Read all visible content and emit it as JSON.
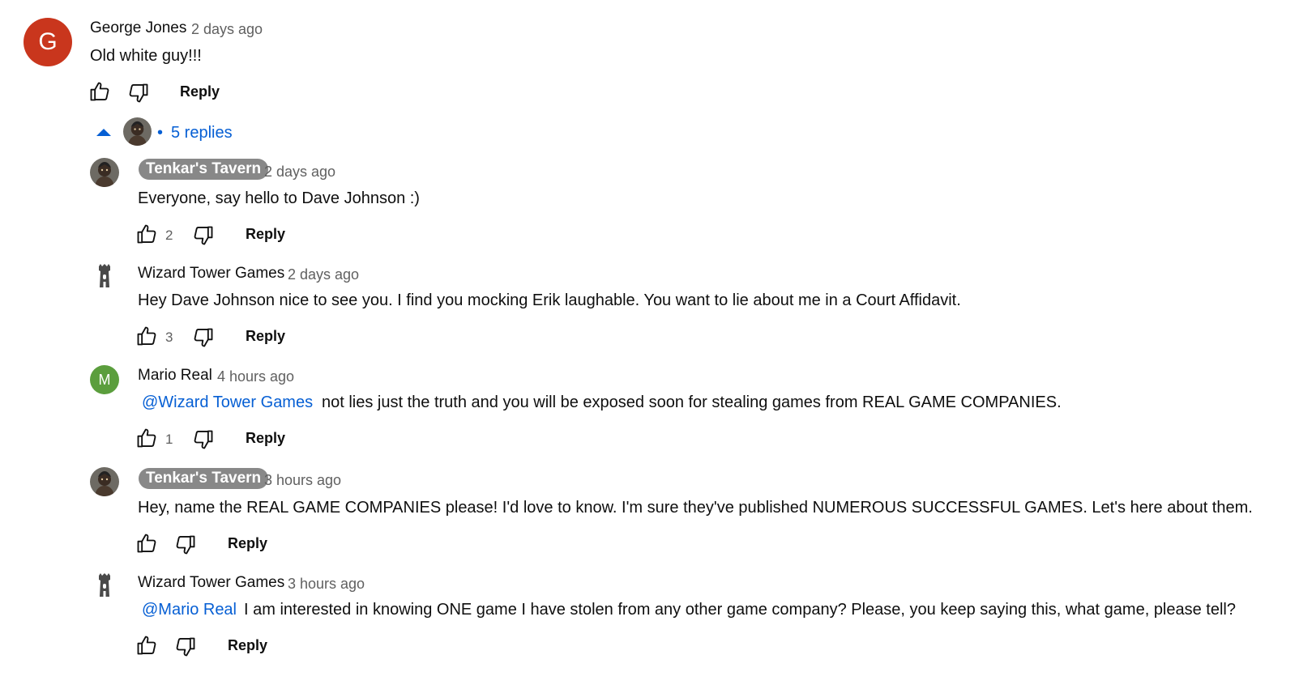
{
  "top_comment": {
    "avatar_letter": "G",
    "avatar_color": "#c9361d",
    "author": "George Jones",
    "time": "2 days ago",
    "text": "Old white guy!!!",
    "reply_label": "Reply"
  },
  "replies_toggle": {
    "bullet": "•",
    "label": "5 replies"
  },
  "replies": [
    {
      "author": "Tenkar's Tavern",
      "time": "2 days ago",
      "text": "Everyone, say hello to Dave Johnson :)",
      "likes": "2",
      "reply_label": "Reply"
    },
    {
      "author": "Wizard Tower Games",
      "time": "2 days ago",
      "text": "Hey Dave Johnson nice to see you. I find you mocking Erik laughable. You want to lie about me in a Court Affidavit.",
      "likes": "3",
      "reply_label": "Reply"
    },
    {
      "author": "Mario Real",
      "avatar_letter": "M",
      "avatar_color": "#5b9e3d",
      "time": "4 hours ago",
      "mention": "@Wizard Tower Games",
      "text": "not lies just the truth and you will be exposed soon for stealing games from REAL GAME COMPANIES.",
      "likes": "1",
      "reply_label": "Reply"
    },
    {
      "author": "Tenkar's Tavern",
      "time": "3 hours ago",
      "text": "Hey, name the REAL GAME COMPANIES please! I'd love to know. I'm sure they've published NUMEROUS SUCCESSFUL GAMES. Let's here about them.",
      "reply_label": "Reply"
    },
    {
      "author": "Wizard Tower Games",
      "time": "3 hours ago",
      "mention": "@Mario Real",
      "text": "I am interested in knowing ONE game I have stolen from any other game company? Please, you keep saying this, what game, please tell?",
      "reply_label": "Reply"
    }
  ],
  "colors": {
    "link_blue": "#065fd4",
    "muted_text": "#606060",
    "owner_chip": "#888888"
  }
}
